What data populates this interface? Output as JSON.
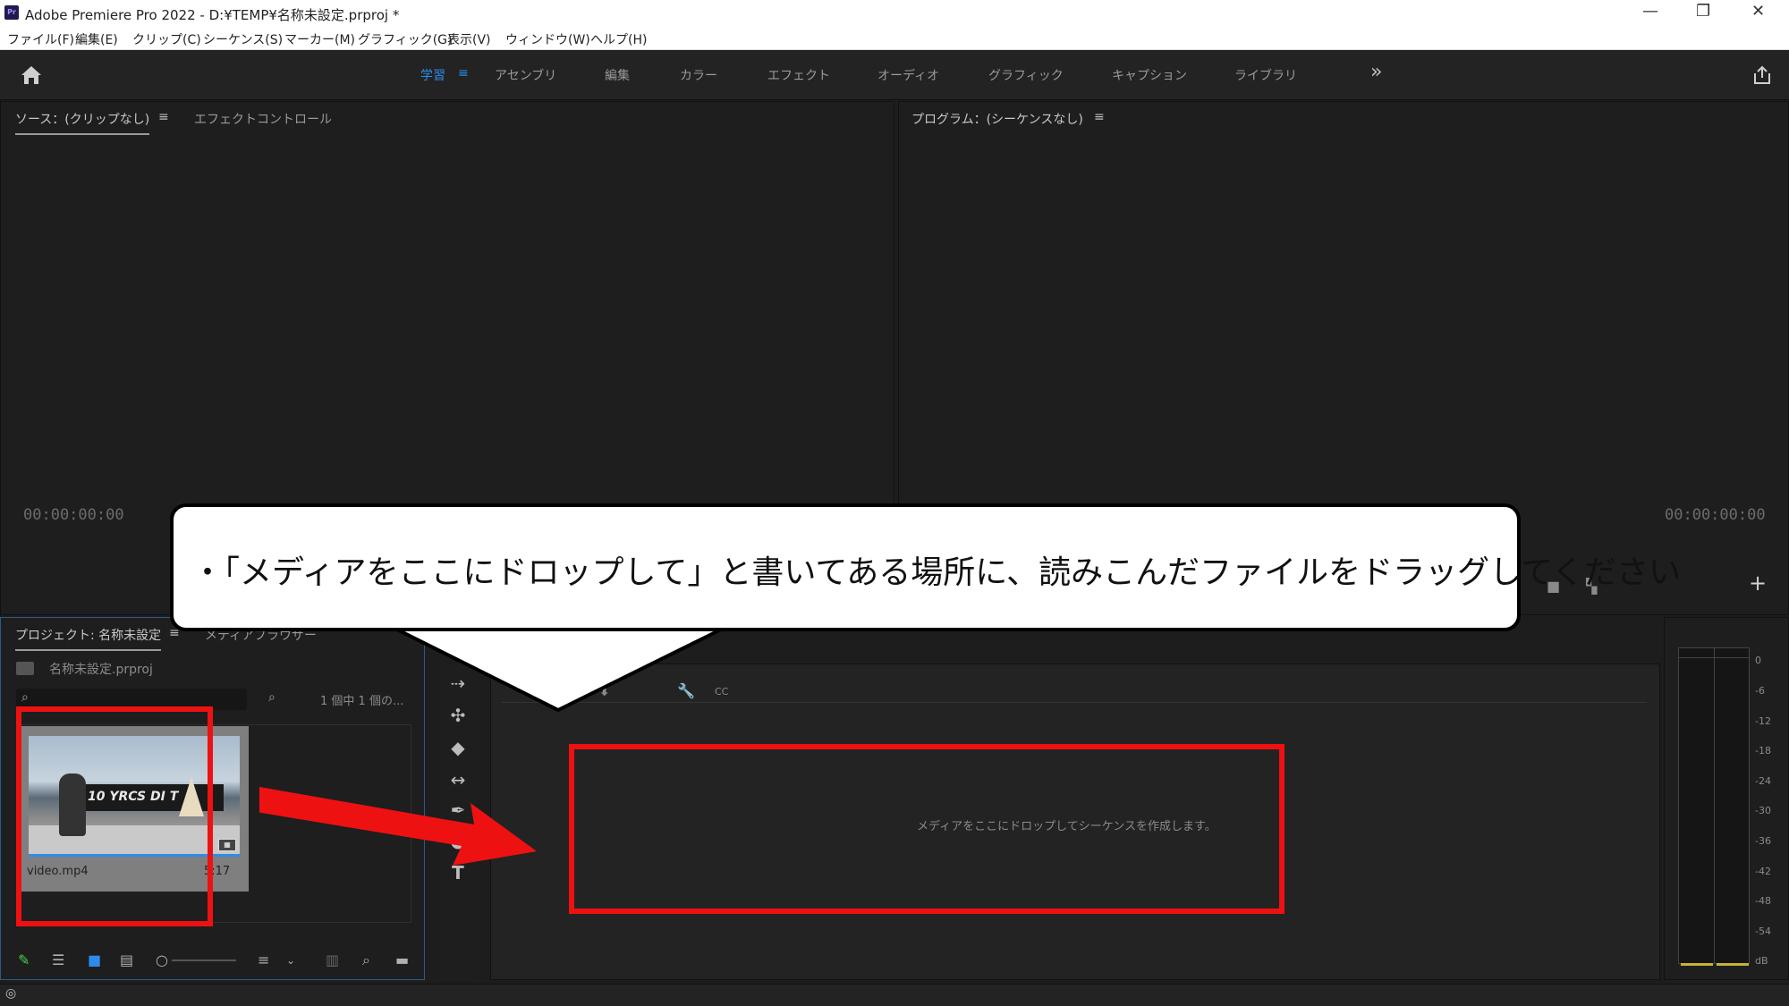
{
  "window": {
    "app_icon_text": "Pr",
    "title": "Adobe Premiere Pro 2022 - D:¥TEMP¥名称未設定.prproj *",
    "minimize": "—",
    "maximize": "❐",
    "close": "✕"
  },
  "menu": [
    "ファイル(F)",
    "編集(E)",
    "クリップ(C)",
    "シーケンス(S)",
    "マーカー(M)",
    "グラフィック(G)",
    "表示(V)",
    "ウィンドウ(W)",
    "ヘルプ(H)"
  ],
  "workspaces": {
    "items": [
      "学習",
      "アセンブリ",
      "編集",
      "カラー",
      "エフェクト",
      "オーディオ",
      "グラフィック",
      "キャプション",
      "ライブラリ"
    ],
    "active": "学習",
    "overflow": "»"
  },
  "source_panel": {
    "tab_source": "ソース：(クリップなし)",
    "tab_effects": "エフェクトコントロール",
    "timecode": "00:00:00:00"
  },
  "program_panel": {
    "tab": "プログラム：(シーケンスなし)",
    "timecode": "00:00:00:00",
    "add": "+"
  },
  "project_panel": {
    "tab": "プロジェクト: 名称未設定",
    "tab2": "メディアブラウザー",
    "file": "名称未設定.prproj",
    "search_placeholder": "",
    "count": "1 個中 1 個の...",
    "clip": {
      "name": "video.mp4",
      "duration": "5:17",
      "thumb_text": "10 YRCS DI T"
    }
  },
  "timeline": {
    "drop_text": "メディアをここにドロップしてシーケンスを作成します。"
  },
  "meter": {
    "scale": [
      "0",
      "-6",
      "-12",
      "-18",
      "-24",
      "-30",
      "-36",
      "-42",
      "-48",
      "-54",
      "dB"
    ]
  },
  "annotation": {
    "text": "・「メディアをここにドロップして」と書いてある場所に、読みこんだファイルをドラッグしてください",
    "colors": {
      "highlight": "#ee1111",
      "callout_bg": "#ffffff"
    }
  },
  "colors": {
    "accent": "#2d8ceb",
    "panel_bg": "#1e1e1e"
  }
}
